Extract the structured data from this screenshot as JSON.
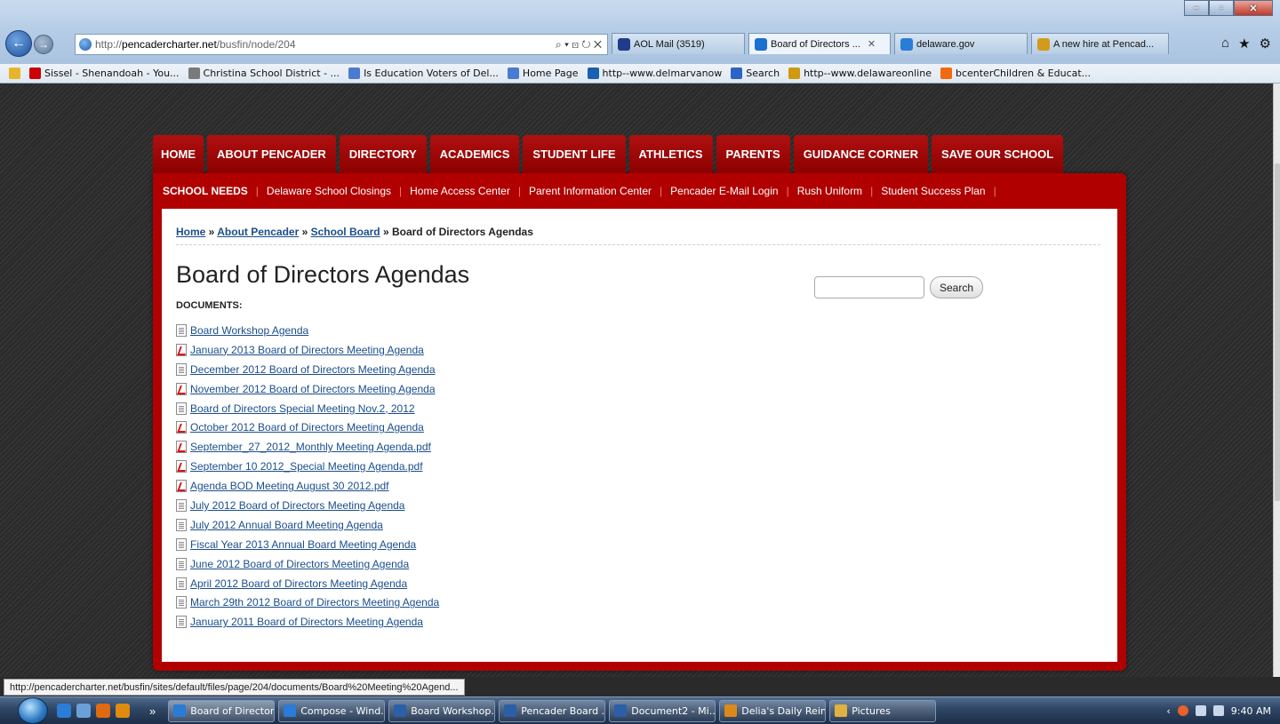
{
  "browser": {
    "url_prefix": "http://",
    "url_host": "pencadercharter.net",
    "url_path": "/busfin/node/204",
    "address_tools": "⌕ ▾ ⊡ ↻ ✕",
    "tabs": [
      {
        "label": "AOL Mail (3519)",
        "color": "#1f3c8a"
      },
      {
        "label": "Board of Directors ...",
        "color": "#1d6fd0"
      },
      {
        "label": "delaware.gov",
        "color": "#2a7cd6"
      },
      {
        "label": "A new hire at Pencad...",
        "color": "#d29b1a"
      }
    ],
    "favorites": [
      {
        "label": "Sissel - Shenandoah - You...",
        "color": "#cc0000"
      },
      {
        "label": "Christina School District - ...",
        "color": "#7a7a7a"
      },
      {
        "label": "Is Education Voters of Del...",
        "color": "#4a7bd0"
      },
      {
        "label": "Home Page",
        "color": "#4a7bd0"
      },
      {
        "label": "http--www.delmarvanow",
        "color": "#1a5fb0"
      },
      {
        "label": "Search",
        "color": "#2b64c4"
      },
      {
        "label": "http--www.delawareonline",
        "color": "#d09a10"
      },
      {
        "label": "bcenterChildren & Educat...",
        "color": "#f06a10"
      }
    ]
  },
  "site": {
    "main_nav": [
      "HOME",
      "ABOUT PENCADER",
      "DIRECTORY",
      "ACADEMICS",
      "STUDENT LIFE",
      "ATHLETICS",
      "PARENTS",
      "GUIDANCE CORNER",
      "SAVE OUR SCHOOL"
    ],
    "sub_nav": [
      "SCHOOL NEEDS",
      "Delaware School Closings",
      "Home Access Center",
      "Parent Information Center",
      "Pencader E-Mail Login",
      "Rush Uniform",
      "Student Success Plan"
    ],
    "breadcrumb": {
      "home": "Home",
      "sep1": " » ",
      "about": "About Pencader",
      "sep2": " » ",
      "board": "School Board",
      "sep3": " » ",
      "current": "Board of Directors Agendas"
    },
    "page_title": "Board of Directors Agendas",
    "documents_label": "DOCUMENTS:",
    "search": {
      "placeholder": "",
      "button_label": "Search"
    },
    "documents": [
      {
        "label": "Board Workshop Agenda",
        "type": "doc"
      },
      {
        "label": "January 2013 Board of Directors Meeting Agenda",
        "type": "pdf"
      },
      {
        "label": "December 2012 Board of Directors Meeting Agenda",
        "type": "doc"
      },
      {
        "label": "November 2012 Board of Directors Meeting Agenda",
        "type": "pdf"
      },
      {
        "label": "Board of Directors Special Meeting Nov.2, 2012",
        "type": "doc"
      },
      {
        "label": "October 2012 Board of Directors Meeting Agenda",
        "type": "pdf"
      },
      {
        "label": "September_27_2012_Monthly Meeting Agenda.pdf",
        "type": "pdf"
      },
      {
        "label": "September 10 2012_Special Meeting Agenda.pdf",
        "type": "pdf"
      },
      {
        "label": "Agenda BOD Meeting August 30 2012.pdf",
        "type": "pdf"
      },
      {
        "label": "July 2012 Board of Directors Meeting Agenda",
        "type": "doc"
      },
      {
        "label": "July 2012 Annual Board Meeting Agenda",
        "type": "doc"
      },
      {
        "label": "Fiscal Year 2013 Annual Board Meeting Agenda",
        "type": "doc"
      },
      {
        "label": "June 2012 Board of Directors Meeting Agenda",
        "type": "doc"
      },
      {
        "label": "April 2012 Board of Directors Meeting Agenda",
        "type": "doc"
      },
      {
        "label": "March 29th 2012 Board of Directors Meeting Agenda",
        "type": "doc"
      },
      {
        "label": "January 2011 Board of Directors Meeting Agenda",
        "type": "doc"
      }
    ]
  },
  "status_url": "http://pencadercharter.net/busfin/sites/default/files/page/204/documents/Board%20Meeting%20Agend...",
  "taskbar": {
    "more": "»",
    "buttons": [
      {
        "label": "Board of Director...",
        "color": "#2a7cd6"
      },
      {
        "label": "Compose - Wind...",
        "color": "#2a7cd6"
      },
      {
        "label": "Board Workshop...",
        "color": "#2b5fa8"
      },
      {
        "label": "Pencader Board ...",
        "color": "#2b5fa8"
      },
      {
        "label": "Document2 - Mi...",
        "color": "#2b5fa8"
      },
      {
        "label": "Delia's Daily Rein...",
        "color": "#d98a1a"
      },
      {
        "label": "Pictures",
        "color": "#e0b040"
      }
    ],
    "clock": "9:40 AM"
  },
  "colors": {
    "nav_red": "#b10000",
    "link_blue": "#1a4e8c"
  }
}
